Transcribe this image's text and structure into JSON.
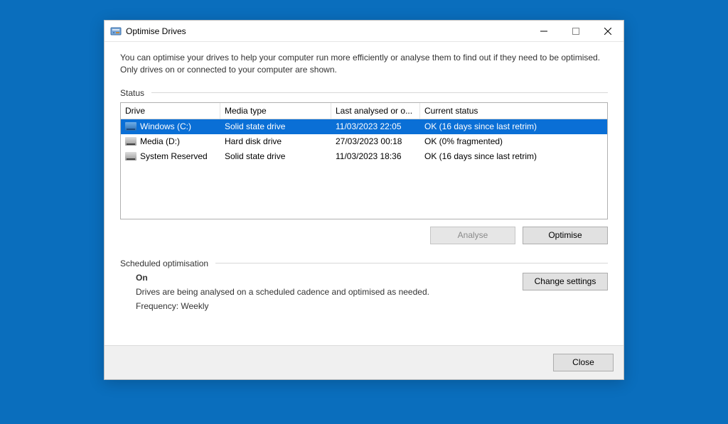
{
  "window": {
    "title": "Optimise Drives"
  },
  "description": "You can optimise your drives to help your computer run more efficiently or analyse them to find out if they need to be optimised. Only drives on or connected to your computer are shown.",
  "status": {
    "label": "Status",
    "headers": {
      "drive": "Drive",
      "media": "Media type",
      "analysed": "Last analysed or o...",
      "status": "Current status"
    },
    "rows": [
      {
        "icon": "ssd",
        "drive": "Windows (C:)",
        "media": "Solid state drive",
        "analysed": "11/03/2023 22:05",
        "status": "OK (16 days since last retrim)",
        "selected": true
      },
      {
        "icon": "hdd",
        "drive": "Media (D:)",
        "media": "Hard disk drive",
        "analysed": "27/03/2023 00:18",
        "status": "OK (0% fragmented)",
        "selected": false
      },
      {
        "icon": "hdd",
        "drive": "System Reserved",
        "media": "Solid state drive",
        "analysed": "11/03/2023 18:36",
        "status": "OK (16 days since last retrim)",
        "selected": false
      }
    ]
  },
  "buttons": {
    "analyse": "Analyse",
    "optimise": "Optimise",
    "change_settings": "Change settings",
    "close": "Close"
  },
  "scheduled": {
    "label": "Scheduled optimisation",
    "state": "On",
    "desc": "Drives are being analysed on a scheduled cadence and optimised as needed.",
    "frequency_label": "Frequency: Weekly"
  }
}
